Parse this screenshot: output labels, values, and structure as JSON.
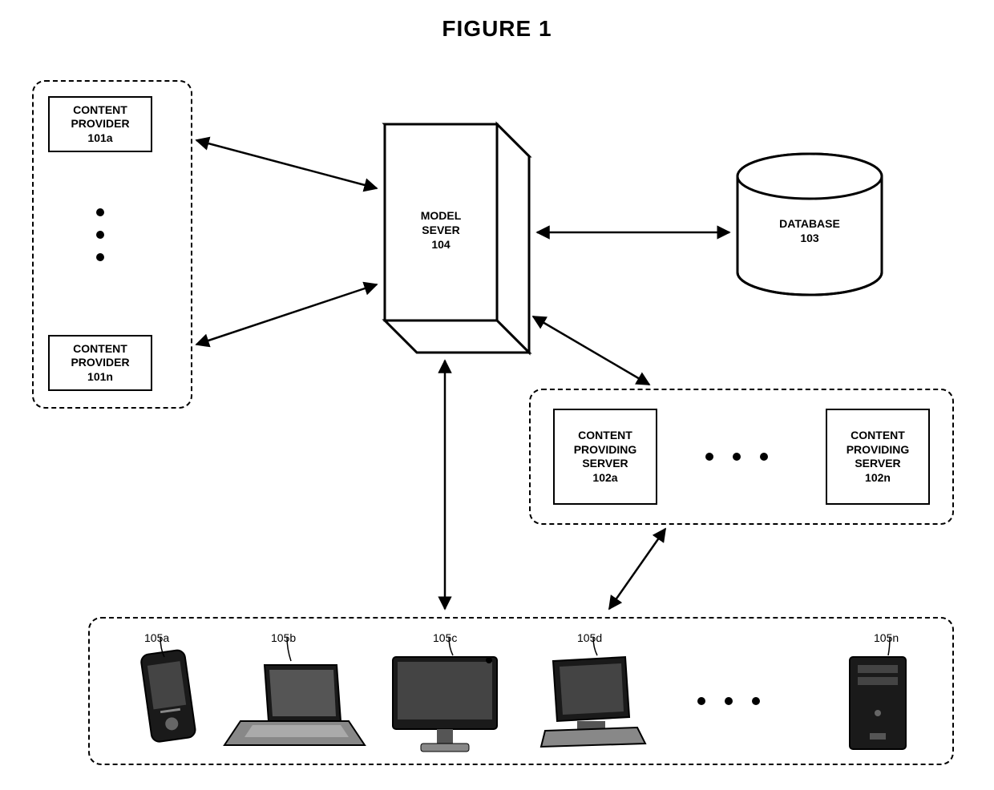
{
  "title": "FIGURE 1",
  "provider_group": {
    "box_a": {
      "line1": "CONTENT",
      "line2": "PROVIDER",
      "id": "101a"
    },
    "box_n": {
      "line1": "CONTENT",
      "line2": "PROVIDER",
      "id": "101n"
    }
  },
  "model_server": {
    "line1": "MODEL",
    "line2": "SEVER",
    "id": "104"
  },
  "database": {
    "label": "DATABASE",
    "id": "103"
  },
  "cps_group": {
    "box_a": {
      "line1": "CONTENT",
      "line2": "PROVIDING",
      "line3": "SERVER",
      "id": "102a"
    },
    "box_n": {
      "line1": "CONTENT",
      "line2": "PROVIDING",
      "line3": "SERVER",
      "id": "102n"
    }
  },
  "devices": {
    "a": "105a",
    "b": "105b",
    "c": "105c",
    "d": "105d",
    "n": "105n"
  }
}
